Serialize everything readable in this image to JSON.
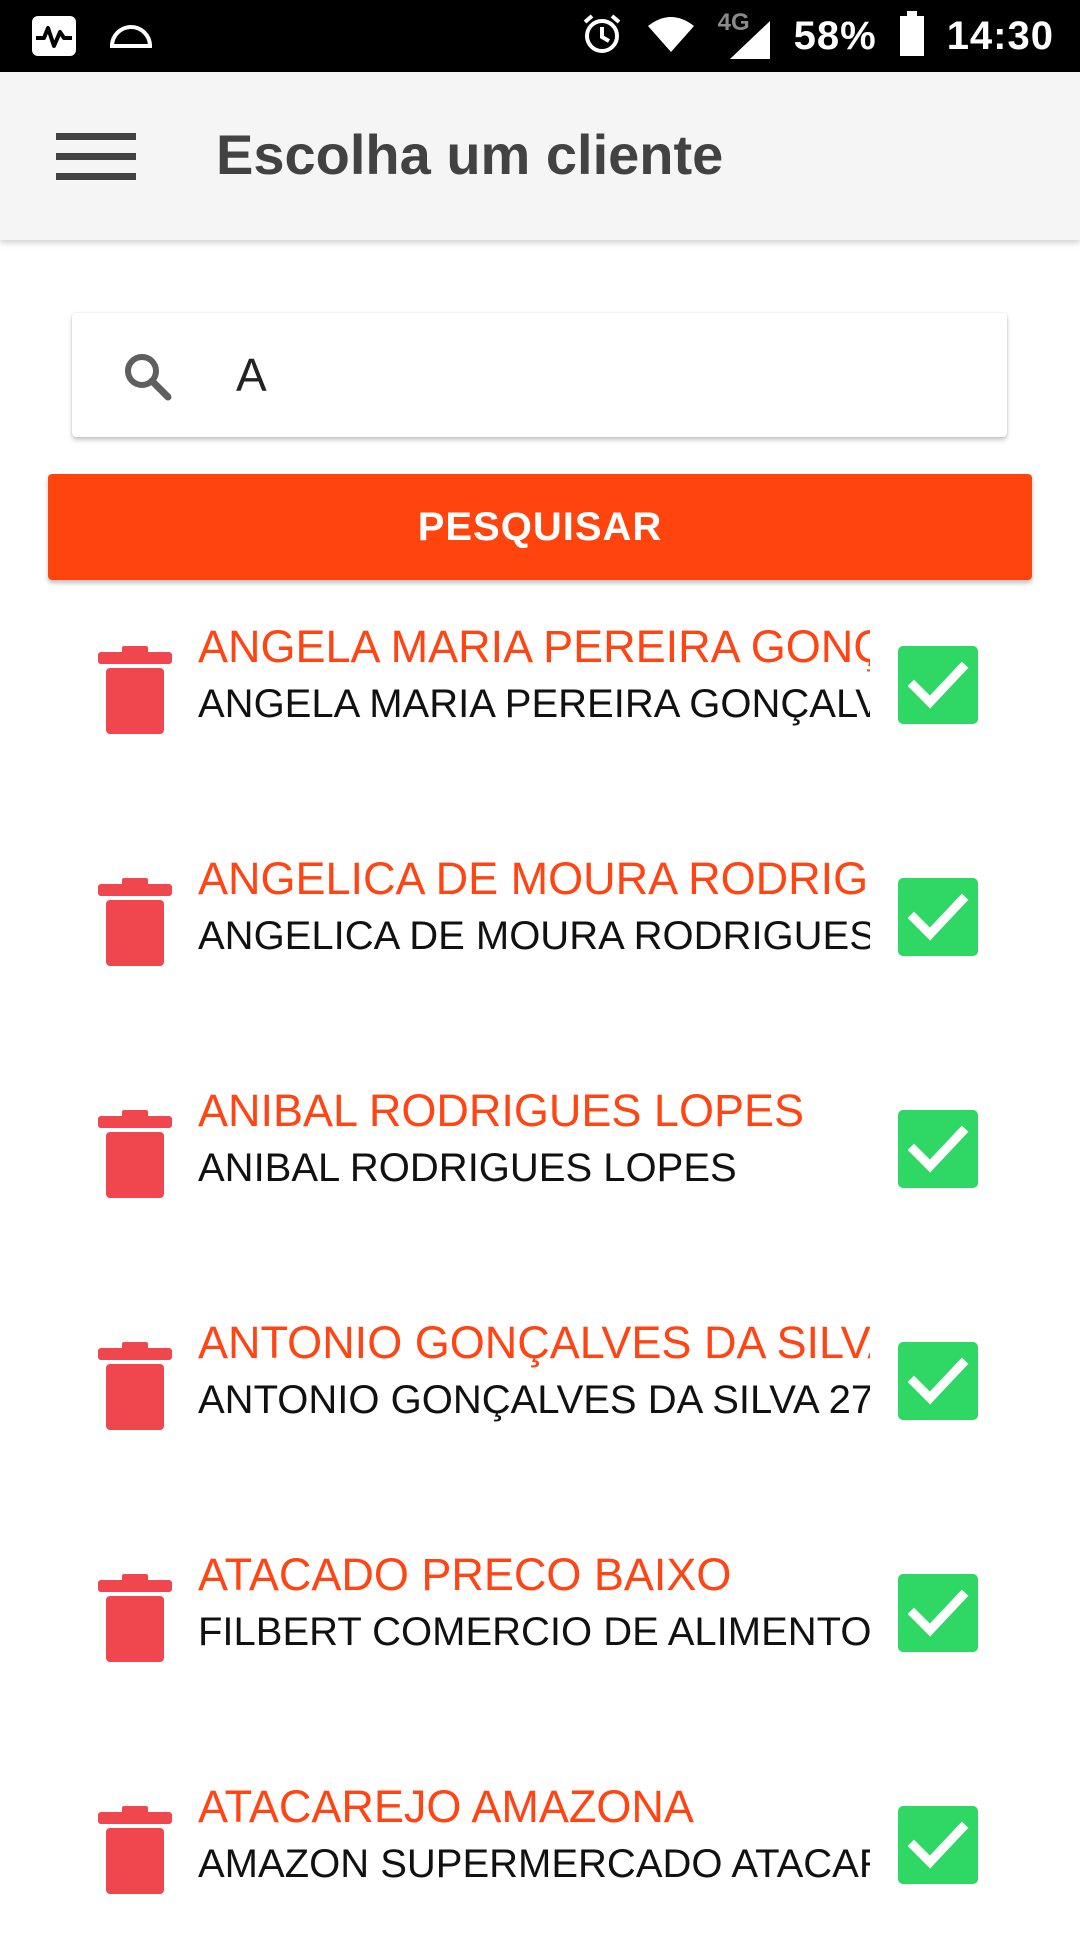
{
  "status_bar": {
    "network_type": "4G",
    "battery_percent": "58%",
    "time": "14:30",
    "icons": [
      "activity-icon",
      "dome-icon",
      "alarm-icon",
      "wifi-icon",
      "signal-icon",
      "battery-icon"
    ]
  },
  "app_bar": {
    "title": "Escolha um cliente",
    "menu_icon": "hamburger-menu-icon"
  },
  "search": {
    "value": "A",
    "icon": "search-icon",
    "button_label": "PESQUISAR"
  },
  "colors": {
    "accent": "#ff440e",
    "name_text": "#ff4513",
    "confirm": "#2fd865",
    "delete": "#f0474e"
  },
  "clients": [
    {
      "name": "ANGELA MARIA PEREIRA GONÇALVES",
      "sub": "ANGELA MARIA PEREIRA GONÇALVES"
    },
    {
      "name": "ANGELICA DE MOURA RODRIGUES",
      "sub": "ANGELICA DE MOURA RODRIGUES"
    },
    {
      "name": "ANIBAL RODRIGUES LOPES",
      "sub": "ANIBAL RODRIGUES LOPES"
    },
    {
      "name": "ANTONIO GONÇALVES DA SILVA",
      "sub": "ANTONIO GONÇALVES DA SILVA 27"
    },
    {
      "name": "ATACADO PRECO BAIXO",
      "sub": "FILBERT COMERCIO DE ALIMENTOS"
    },
    {
      "name": "ATACAREJO AMAZONA",
      "sub": "AMAZON SUPERMERCADO ATACAREJO"
    }
  ]
}
